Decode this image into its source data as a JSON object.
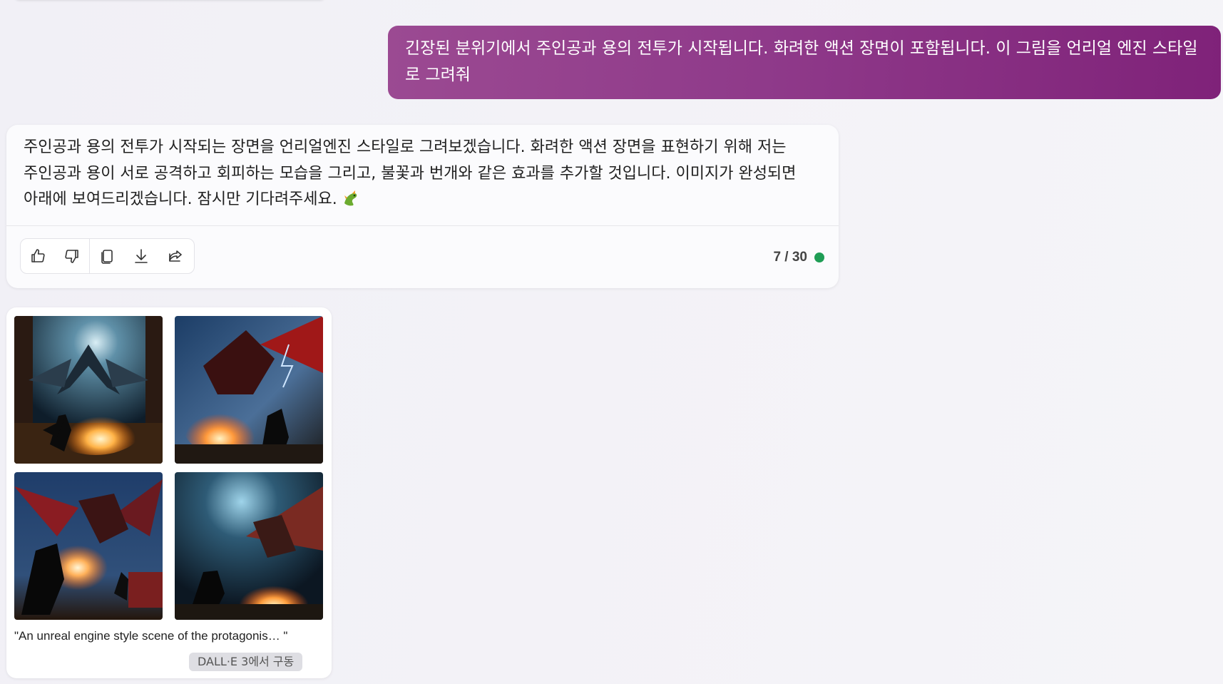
{
  "user_message": {
    "text": "긴장된 분위기에서 주인공과 용의 전투가 시작됩니다. 화려한 액션 장면이 포함됩니다. 이 그림을 언리얼 엔진 스타일로 그려줘"
  },
  "assistant_message": {
    "text": "주인공과 용의 전투가 시작되는 장면을 언리얼엔진 스타일로 그려보겠습니다. 화려한 액션 장면을 표현하기 위해 저는 주인공과 용이 서로 공격하고 회피하는 모습을 그리고, 불꽃과 번개와 같은 효과를 추가할 것입니다. 이미지가 완성되면 아래에 보여드리겠습니다. 잠시만 기다려주세요.",
    "emoji_icon": "dragon-emoji-icon"
  },
  "toolbar": {
    "actions": [
      "thumbs-up-icon",
      "thumbs-down-icon",
      "copy-icon",
      "download-icon",
      "share-icon"
    ]
  },
  "counter": {
    "text": "7 / 30",
    "status_color": "#1f9d55"
  },
  "image_result": {
    "caption": "\"An unreal engine style scene of the protagonis… \"",
    "badge": "DALL·E 3에서 구동",
    "image_count": 4
  },
  "colors": {
    "user_bubble": "#8f3a8a",
    "background": "#f2f1f6"
  }
}
